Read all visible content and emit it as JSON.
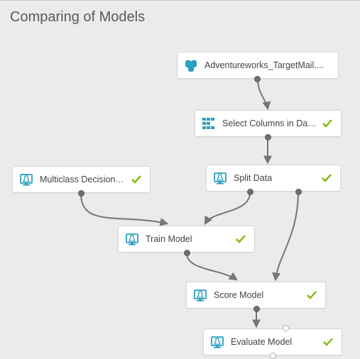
{
  "title": "Comparing of Models",
  "nodes": {
    "dataset": {
      "label": "Adventureworks_TargetMail...."
    },
    "select": {
      "label": "Select Columns in Dataset"
    },
    "split": {
      "label": "Split Data"
    },
    "mcforest": {
      "label": "Multiclass Decision Forest"
    },
    "train": {
      "label": "Train Model"
    },
    "score": {
      "label": "Score Model"
    },
    "evaluate": {
      "label": "Evaluate Model"
    }
  },
  "colors": {
    "datasetIcon": "#2aa0c0",
    "moduleIcon": "#2aa0c0",
    "check": "#7fba00",
    "edge": "#767676"
  }
}
